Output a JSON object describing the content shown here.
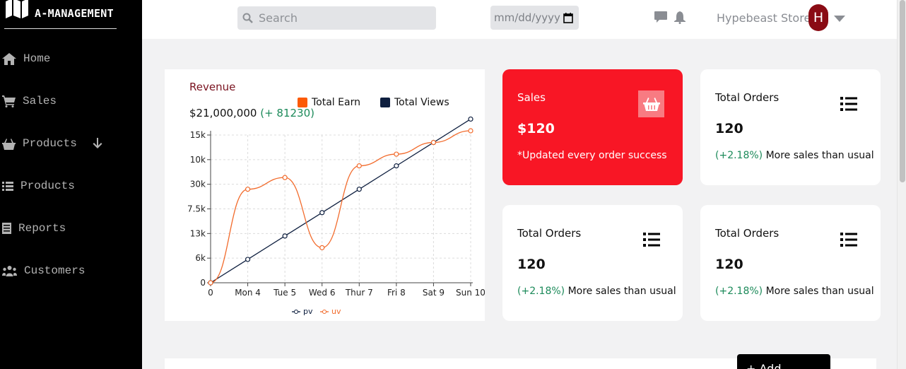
{
  "brand": {
    "name": "A-MANAGEMENT",
    "icon": "map-icon"
  },
  "sidebar": {
    "items": [
      {
        "label": "Home",
        "icon": "home-icon"
      },
      {
        "label": "Sales",
        "icon": "cart-icon"
      },
      {
        "label": "Products",
        "icon": "basket-icon",
        "extra_icon": "arrow-down-icon"
      },
      {
        "label": "Products",
        "icon": "list-icon"
      },
      {
        "label": "Reports",
        "icon": "document-icon"
      },
      {
        "label": "Customers",
        "icon": "users-icon"
      }
    ]
  },
  "header": {
    "search_placeholder": "Search",
    "date_placeholder": "mm/dd/yyyy",
    "store_name": "Hypebeast Store",
    "avatar_initial": "H"
  },
  "revenue": {
    "title": "Revenue",
    "amount": "$21,000,000",
    "change": "(+ 81230)",
    "legend": [
      {
        "label": "Total Earn",
        "color": "#fc5a06"
      },
      {
        "label": "Total Views",
        "color": "#0e1f3f"
      }
    ]
  },
  "chart_data": {
    "type": "line",
    "categories": [
      "0",
      "Mon 4",
      "Tue 5",
      "Wed 6",
      "Thur 7",
      "Fri 8",
      "Sat 9",
      "Sun 10"
    ],
    "y_tick_labels": [
      "0",
      "6k",
      "13k",
      "7.5k",
      "30k",
      "10k",
      "15k"
    ],
    "grid": true,
    "series": [
      {
        "name": "pv",
        "color": "#0e1f3f",
        "values": [
          0,
          1,
          2,
          3,
          4,
          5,
          6,
          7
        ]
      },
      {
        "name": "uv",
        "color": "#f26b2c",
        "values": [
          0,
          4,
          4.5,
          1.5,
          5,
          5.5,
          6,
          6.5
        ]
      }
    ],
    "y_range": [
      0,
      6.5
    ],
    "legend_position": "bottom"
  },
  "cards": [
    {
      "title": "Sales",
      "value": "$120",
      "note": "*Updated every order success",
      "style": "red",
      "icon": "basket-icon"
    },
    {
      "title": "Total Orders",
      "value": "120",
      "change": "(+2.18%)",
      "note": "More sales than usual",
      "icon": "list-icon"
    },
    {
      "title": "Total Orders",
      "value": "120",
      "change": "(+2.18%)",
      "note": "More sales than usual",
      "icon": "list-icon"
    },
    {
      "title": "Total Orders",
      "value": "120",
      "change": "(+2.18%)",
      "note": "More sales than usual",
      "icon": "list-icon"
    }
  ],
  "add_button": "+ Add Products"
}
